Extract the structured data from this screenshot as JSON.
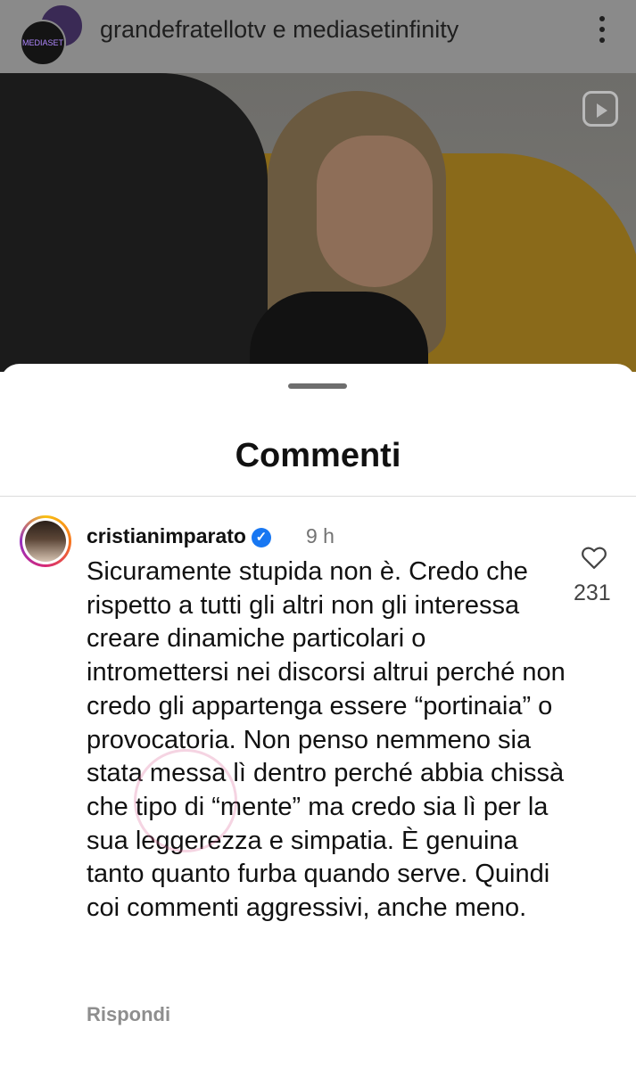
{
  "header": {
    "account_names": "grandefratellotv e mediasetinfinity",
    "avatar_badge": "MEDIASET infinity",
    "more_icon": "more-vertical-icon"
  },
  "video": {
    "reels_icon": "reels-icon"
  },
  "sheet": {
    "title": "Commenti"
  },
  "comment": {
    "username": "cristianimparato",
    "verified": true,
    "time": "9 h",
    "text": "Sicuramente stupida non è. Credo che rispetto a tutti gli altri non gli interessa creare dinamiche particolari o intromettersi nei discorsi altrui perché non credo gli appartenga essere “portinaia” o provocatoria. Non penso nemmeno sia stata messa lì dentro perché abbia chissà che tipo di “mente” ma credo sia lì per la sua leggerezza e simpatia. È genuina tanto quanto furba quando serve. Quindi coi commenti aggressivi, anche meno.",
    "reply_label": "Rispondi",
    "like_count": "231"
  },
  "colors": {
    "verified_blue": "#1877f2",
    "story_ring": "#d62976"
  }
}
